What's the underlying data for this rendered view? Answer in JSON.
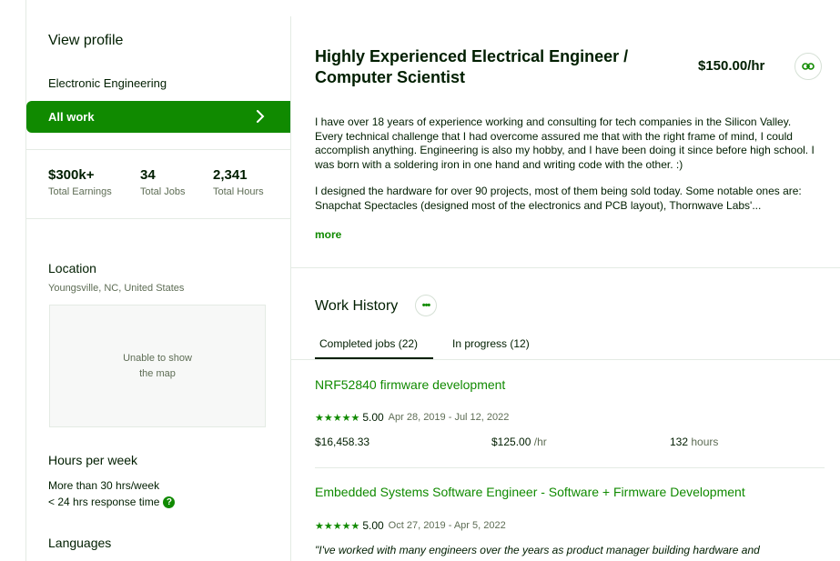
{
  "sidebar": {
    "view_profile": "View profile",
    "specialty": "Electronic Engineering",
    "all_work": "All work",
    "stats": [
      {
        "value": "$300k+",
        "label": "Total Earnings"
      },
      {
        "value": "34",
        "label": "Total Jobs"
      },
      {
        "value": "2,341",
        "label": "Total Hours"
      }
    ],
    "location_title": "Location",
    "location_value": "Youngsville, NC, United States",
    "map_text": "Unable to show the map",
    "hours_title": "Hours per week",
    "hours_value": "More than 30 hrs/week",
    "response_time": "< 24 hrs response time",
    "languages_title": "Languages"
  },
  "profile": {
    "title": "Highly Experienced Electrical Engineer / Computer Scientist",
    "rate": "$150.00/hr",
    "desc_p1": "I have over 18 years of experience working and consulting for tech companies in the Silicon Valley. Every technical challenge that I had overcome assured me that with the right frame of mind, I could accomplish anything. Engineering is also my hobby, and I have been doing it since before high school. I was born with a soldering iron in one hand and writing code with the other. :)",
    "desc_p2": "I designed the hardware for over 90 projects, most of them being sold today. Some notable ones are: Snapchat Spectacles (designed most of the electronics and PCB layout), Thornwave Labs'...",
    "more": "more"
  },
  "work_history": {
    "title": "Work History",
    "tabs": [
      "Completed jobs (22)",
      "In progress (12)"
    ],
    "jobs": [
      {
        "title": "NRF52840 firmware development",
        "stars": "★★★★★",
        "score": "5.00",
        "dates": "Apr 28, 2019 - Jul 12, 2022",
        "earned": "$16,458.33",
        "rate": "$125.00",
        "rate_unit": "/hr",
        "hours": "132",
        "hours_unit": "hours"
      },
      {
        "title": "Embedded Systems Software Engineer - Software + Firmware Development",
        "stars": "★★★★★",
        "score": "5.00",
        "dates": "Oct 27, 2019 - Apr 5, 2022",
        "quote": "\"I've worked with many engineers over the years as product manager building hardware and"
      }
    ]
  },
  "colors": {
    "accent": "#108a00",
    "text": "#001e00",
    "muted": "#5e6d55",
    "border": "#e4ebe4"
  },
  "icons": [
    "chevron-right-icon",
    "link-icon",
    "more-dots-icon",
    "question-icon",
    "star-icon"
  ]
}
